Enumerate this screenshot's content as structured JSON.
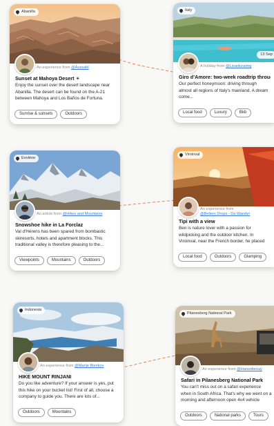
{
  "colors": {
    "connector": "#e8834f",
    "link": "#3a7bd5",
    "tag_border": "#9a9a9a"
  },
  "cards": [
    {
      "id": "abanilla",
      "location": "Abanilla",
      "byline_prefix": "An experience from",
      "author": "@Aussabl",
      "title": "Sunset at Mahoya Desert",
      "title_icon": "sunset-emoji-icon",
      "description": "Enjoy the sunset over the desert landscape near Abanilla.  The desert can be found on the A-21 between Mahoya and Los Baños de Fortuna.",
      "tags": [
        "Sunrise & sunsets",
        "Outdoors"
      ]
    },
    {
      "id": "italy",
      "location": "Italy",
      "date": "13 Sep",
      "byline_prefix": "A holiday from",
      "author": "@Lisanluraimg",
      "title": "Giro d’Amore: two-week roadtrip through Italy",
      "description": "Our perfect honeymoon: driving through almost all regions of Italy's mainland. A dream come...",
      "tags": [
        "Local food",
        "Luxury",
        "Bkb"
      ]
    },
    {
      "id": "evolene",
      "location": "Evolène",
      "byline_prefix": "An article from",
      "author": "@Hikes and Mountains",
      "title": "Snowshoe hike in La Forclaz",
      "description": "Val d'Hérens has been spared from bombastic skiresorts, hotels and apartment blocks. This traditional valley is therefore pleasing to the...",
      "tags": [
        "Viewpoints",
        "Mountains",
        "Outdoors"
      ]
    },
    {
      "id": "viroinval",
      "location": "Viroinval",
      "byline_prefix": "An experience from",
      "author": "@Beliers Drops - Da Wander",
      "title": "Tipi with a view",
      "description": "Ben is nature lover with a passion for wildpicking and the outdoor kitchen. In Viroinval, near the French border, he placed two...",
      "tags": [
        "Local food",
        "Outdoors",
        "Glamping"
      ]
    },
    {
      "id": "indonesia",
      "location": "Indonesia",
      "byline_prefix": "An experience from",
      "author": "@Marije Blenkov",
      "title": "HIKE MOUNT RINJANI",
      "description": "Do you like adventure? If your answer is yes, put this hike on your bucket list! First of all, choose a company to guide you. There are lots of...",
      "tags": [
        "Outdoors",
        "Mountains"
      ]
    },
    {
      "id": "pilanesberg",
      "location": "Pilanesberg National Park",
      "byline_prefix": "An experience from",
      "author": "@Hansnbexay",
      "title": "Safari in Pilanesberg National Park",
      "description": "You can't miss out on a safari experience when in South Africa. That's why we went on a morning and afternoon open 4x4 vehicle safari...",
      "tags": [
        "Outdoors",
        "National parks",
        "Tours"
      ]
    }
  ]
}
